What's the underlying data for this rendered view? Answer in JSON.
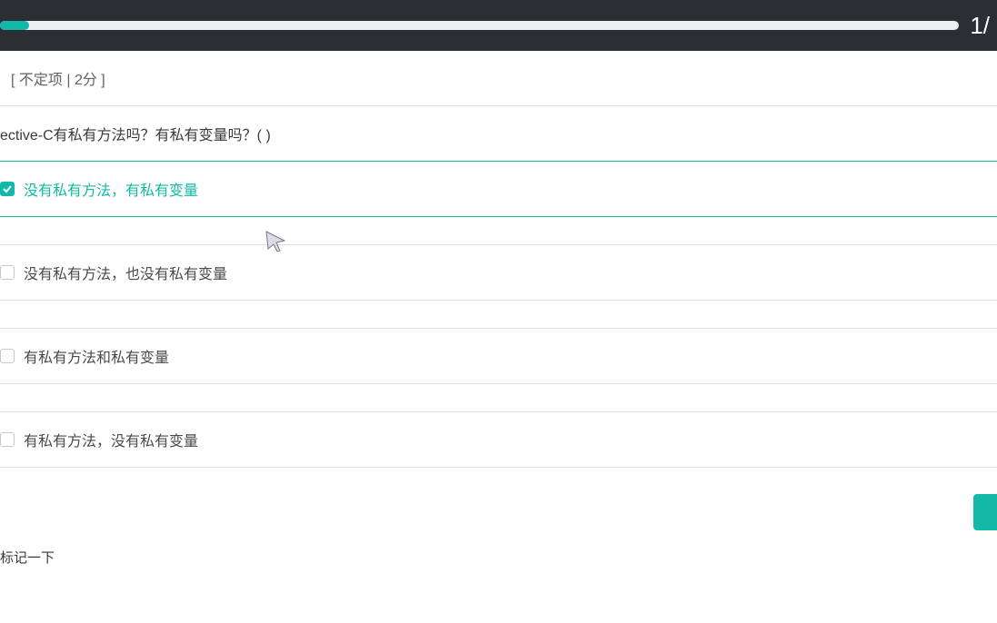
{
  "progress": {
    "percent": 3,
    "counter": "1/"
  },
  "meta_label": "[ 不定项 | 2分 ]",
  "question_text": "ective-C有私有方法吗？有私有变量吗？( )",
  "options": [
    {
      "text": "没有私有方法，有私有变量",
      "selected": true
    },
    {
      "text": "没有私有方法，也没有私有变量",
      "selected": false
    },
    {
      "text": "有私有方法和私有变量",
      "selected": false
    },
    {
      "text": "有私有方法，没有私有变量",
      "selected": false
    }
  ],
  "mark_label": "标记一下",
  "colors": {
    "accent": "#14b8a6",
    "header": "#2b2f33"
  }
}
